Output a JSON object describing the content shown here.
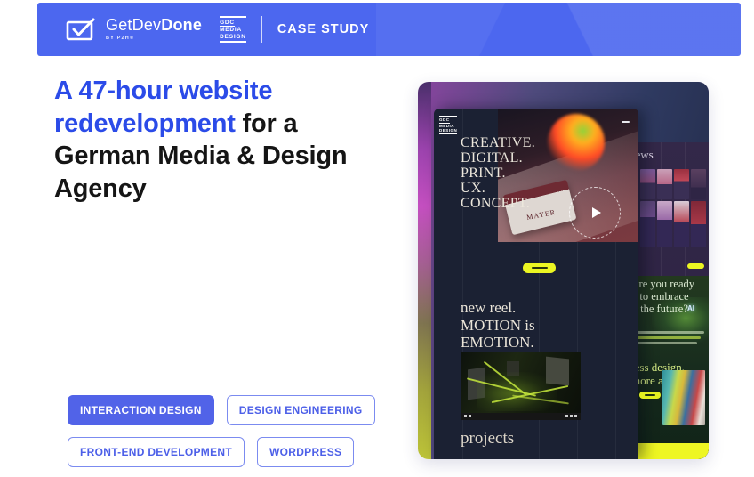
{
  "header": {
    "logo": {
      "get": "Get",
      "dev": "Dev",
      "done": "Done",
      "byline": "BY P2H®"
    },
    "client_logo": {
      "line1": "GDC",
      "line2": "MEDIA",
      "line3": "DESIGN"
    },
    "page_label": "CASE STUDY"
  },
  "hero": {
    "highlight": "A 47-hour website redevelopment",
    "rest": "for a German Media & Design Agency"
  },
  "tags": [
    {
      "label": "INTERACTION DESIGN",
      "variant": "filled"
    },
    {
      "label": "DESIGN ENGINEERING",
      "variant": "outline"
    },
    {
      "label": "FRONT-END DEVELOPMENT",
      "variant": "outline"
    },
    {
      "label": "WORDPRESS",
      "variant": "outline"
    }
  ],
  "preview": {
    "site_logo": {
      "line1": "GDC",
      "line2": "MEDIA",
      "line3": "DESIGN"
    },
    "hero_lines": [
      "CREATIVE.",
      "DIGITAL.",
      "PRINT.",
      "UX.",
      "CONCEPT."
    ],
    "card_label": "MAYER",
    "reel_lines": [
      "new reel.",
      "MOTION is",
      "EMOTION."
    ],
    "projects_label": "projects",
    "news_heading": "news",
    "future_lines": [
      "are you ready",
      "to embrace",
      "the future?"
    ],
    "ai_label": "AI",
    "art_lines": [
      "less design,",
      "more art?"
    ]
  },
  "colors": {
    "header_blue": "#4c67ef",
    "headline_blue": "#2b4be8",
    "tag_blue": "#5163e8",
    "accent_yellow": "#ecf622",
    "panel_navy": "#232c49",
    "panel_magenta": "#c44fc0",
    "screenshot_navy": "#1b2133"
  }
}
